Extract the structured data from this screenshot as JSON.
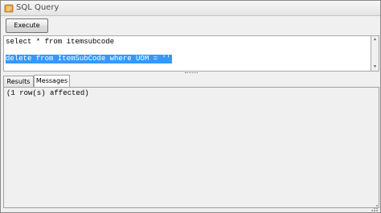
{
  "window": {
    "title": "SQL Query"
  },
  "toolbar": {
    "execute_label": "Execute"
  },
  "editor": {
    "lines": [
      "select * from itemsubcode",
      "",
      "delete from ItemSubCode where UOM = ''"
    ]
  },
  "tabs": {
    "results_label": "Results",
    "messages_label": "Messages"
  },
  "messages": {
    "text": "(1 row(s) affected)"
  },
  "colors": {
    "selection": "#3399ff",
    "icon": "#e8a33c"
  }
}
